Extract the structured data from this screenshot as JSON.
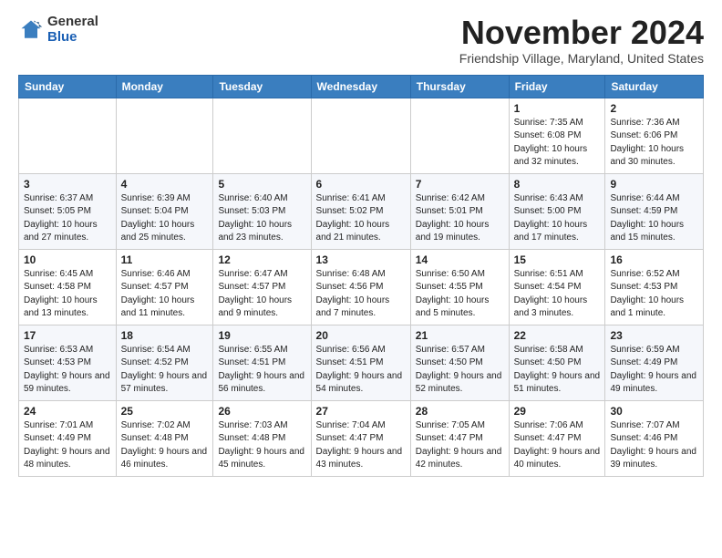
{
  "header": {
    "logo_general": "General",
    "logo_blue": "Blue",
    "month_title": "November 2024",
    "subtitle": "Friendship Village, Maryland, United States"
  },
  "days_of_week": [
    "Sunday",
    "Monday",
    "Tuesday",
    "Wednesday",
    "Thursday",
    "Friday",
    "Saturday"
  ],
  "weeks": [
    [
      {
        "day": "",
        "info": ""
      },
      {
        "day": "",
        "info": ""
      },
      {
        "day": "",
        "info": ""
      },
      {
        "day": "",
        "info": ""
      },
      {
        "day": "",
        "info": ""
      },
      {
        "day": "1",
        "info": "Sunrise: 7:35 AM\nSunset: 6:08 PM\nDaylight: 10 hours and 32 minutes."
      },
      {
        "day": "2",
        "info": "Sunrise: 7:36 AM\nSunset: 6:06 PM\nDaylight: 10 hours and 30 minutes."
      }
    ],
    [
      {
        "day": "3",
        "info": "Sunrise: 6:37 AM\nSunset: 5:05 PM\nDaylight: 10 hours and 27 minutes."
      },
      {
        "day": "4",
        "info": "Sunrise: 6:39 AM\nSunset: 5:04 PM\nDaylight: 10 hours and 25 minutes."
      },
      {
        "day": "5",
        "info": "Sunrise: 6:40 AM\nSunset: 5:03 PM\nDaylight: 10 hours and 23 minutes."
      },
      {
        "day": "6",
        "info": "Sunrise: 6:41 AM\nSunset: 5:02 PM\nDaylight: 10 hours and 21 minutes."
      },
      {
        "day": "7",
        "info": "Sunrise: 6:42 AM\nSunset: 5:01 PM\nDaylight: 10 hours and 19 minutes."
      },
      {
        "day": "8",
        "info": "Sunrise: 6:43 AM\nSunset: 5:00 PM\nDaylight: 10 hours and 17 minutes."
      },
      {
        "day": "9",
        "info": "Sunrise: 6:44 AM\nSunset: 4:59 PM\nDaylight: 10 hours and 15 minutes."
      }
    ],
    [
      {
        "day": "10",
        "info": "Sunrise: 6:45 AM\nSunset: 4:58 PM\nDaylight: 10 hours and 13 minutes."
      },
      {
        "day": "11",
        "info": "Sunrise: 6:46 AM\nSunset: 4:57 PM\nDaylight: 10 hours and 11 minutes."
      },
      {
        "day": "12",
        "info": "Sunrise: 6:47 AM\nSunset: 4:57 PM\nDaylight: 10 hours and 9 minutes."
      },
      {
        "day": "13",
        "info": "Sunrise: 6:48 AM\nSunset: 4:56 PM\nDaylight: 10 hours and 7 minutes."
      },
      {
        "day": "14",
        "info": "Sunrise: 6:50 AM\nSunset: 4:55 PM\nDaylight: 10 hours and 5 minutes."
      },
      {
        "day": "15",
        "info": "Sunrise: 6:51 AM\nSunset: 4:54 PM\nDaylight: 10 hours and 3 minutes."
      },
      {
        "day": "16",
        "info": "Sunrise: 6:52 AM\nSunset: 4:53 PM\nDaylight: 10 hours and 1 minute."
      }
    ],
    [
      {
        "day": "17",
        "info": "Sunrise: 6:53 AM\nSunset: 4:53 PM\nDaylight: 9 hours and 59 minutes."
      },
      {
        "day": "18",
        "info": "Sunrise: 6:54 AM\nSunset: 4:52 PM\nDaylight: 9 hours and 57 minutes."
      },
      {
        "day": "19",
        "info": "Sunrise: 6:55 AM\nSunset: 4:51 PM\nDaylight: 9 hours and 56 minutes."
      },
      {
        "day": "20",
        "info": "Sunrise: 6:56 AM\nSunset: 4:51 PM\nDaylight: 9 hours and 54 minutes."
      },
      {
        "day": "21",
        "info": "Sunrise: 6:57 AM\nSunset: 4:50 PM\nDaylight: 9 hours and 52 minutes."
      },
      {
        "day": "22",
        "info": "Sunrise: 6:58 AM\nSunset: 4:50 PM\nDaylight: 9 hours and 51 minutes."
      },
      {
        "day": "23",
        "info": "Sunrise: 6:59 AM\nSunset: 4:49 PM\nDaylight: 9 hours and 49 minutes."
      }
    ],
    [
      {
        "day": "24",
        "info": "Sunrise: 7:01 AM\nSunset: 4:49 PM\nDaylight: 9 hours and 48 minutes."
      },
      {
        "day": "25",
        "info": "Sunrise: 7:02 AM\nSunset: 4:48 PM\nDaylight: 9 hours and 46 minutes."
      },
      {
        "day": "26",
        "info": "Sunrise: 7:03 AM\nSunset: 4:48 PM\nDaylight: 9 hours and 45 minutes."
      },
      {
        "day": "27",
        "info": "Sunrise: 7:04 AM\nSunset: 4:47 PM\nDaylight: 9 hours and 43 minutes."
      },
      {
        "day": "28",
        "info": "Sunrise: 7:05 AM\nSunset: 4:47 PM\nDaylight: 9 hours and 42 minutes."
      },
      {
        "day": "29",
        "info": "Sunrise: 7:06 AM\nSunset: 4:47 PM\nDaylight: 9 hours and 40 minutes."
      },
      {
        "day": "30",
        "info": "Sunrise: 7:07 AM\nSunset: 4:46 PM\nDaylight: 9 hours and 39 minutes."
      }
    ]
  ]
}
